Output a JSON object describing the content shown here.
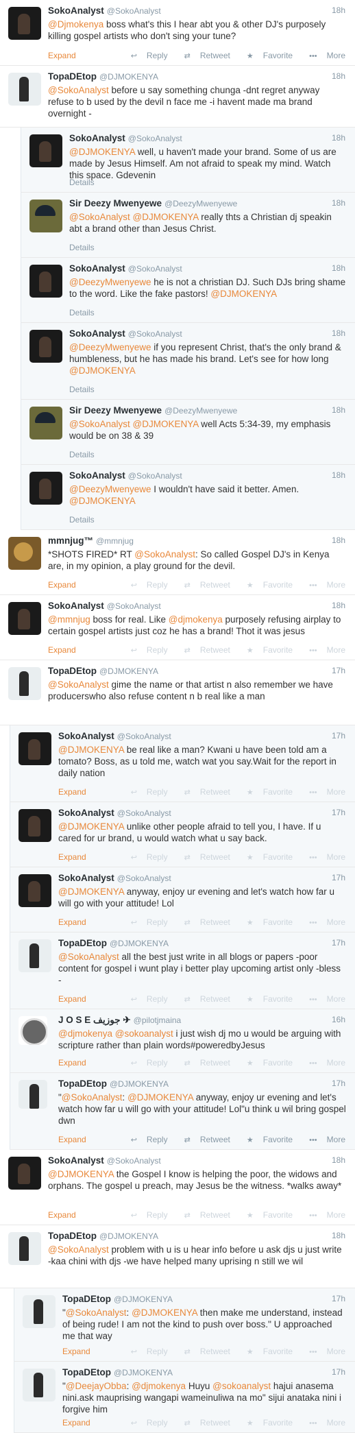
{
  "labels": {
    "expand": "Expand",
    "details": "Details",
    "reply": "Reply",
    "retweet": "Retweet",
    "favorite": "Favorite",
    "more": "More"
  },
  "icons": {
    "reply": "reply-arrow-icon",
    "retweet": "retweet-icon",
    "favorite": "star-icon",
    "more": "ellipsis-icon"
  },
  "colors": {
    "mention": "#e8883a",
    "meta": "#8899a6"
  },
  "tweets": [
    {
      "name": "SokoAnalyst",
      "handle": "@SokoAnalyst",
      "time": "18h",
      "mention1": "@Djmokenya",
      "text_main": " boss what's this I hear abt you & other DJ's purposely killing gospel artists who don't sing your tune?"
    },
    {
      "name": "TopaDEtop",
      "handle": "@DJMOKENYA",
      "time": "18h",
      "mention1": "@SokoAnalyst",
      "text_main": " before u say something chunga -dnt regret anyway refuse to b used by the devil n face me -i havent made ma brand overnight -"
    },
    {
      "name": "SokoAnalyst",
      "handle": "@SokoAnalyst",
      "time": "18h",
      "mention1": "@DJMOKENYA",
      "text_main": " well, u haven't made your brand. Some of us are made by Jesus Himself. Am not afraid to speak my mind. Watch this space. Gdevenin"
    },
    {
      "name": "Sir Deezy Mwenyewe",
      "handle": "@DeezyMwenyewe",
      "time": "18h",
      "mention1": "@SokoAnalyst",
      "mention2": "@DJMOKENYA",
      "text_main": " really thts a Christian dj speakin abt a brand other than Jesus Christ."
    },
    {
      "name": "SokoAnalyst",
      "handle": "@SokoAnalyst",
      "time": "18h",
      "mention1": "@DeezyMwenyewe",
      "text_main": " he is not a christian DJ. Such DJs bring shame to the word. Like the fake pastors! ",
      "mention_end": "@DJMOKENYA"
    },
    {
      "name": "SokoAnalyst",
      "handle": "@SokoAnalyst",
      "time": "18h",
      "mention1": "@DeezyMwenyewe",
      "text_main": " if you represent Christ, that's the only brand & humbleness, but he has made his brand. Let's see for how long ",
      "mention_end": "@DJMOKENYA"
    },
    {
      "name": "Sir Deezy Mwenyewe",
      "handle": "@DeezyMwenyewe",
      "time": "18h",
      "mention1": "@SokoAnalyst",
      "mention2": "@DJMOKENYA",
      "text_main": " well Acts 5:34-39, my emphasis would be on 38 & 39"
    },
    {
      "name": "SokoAnalyst",
      "handle": "@SokoAnalyst",
      "time": "18h",
      "mention1": "@DeezyMwenyewe",
      "text_main": " I wouldn't have said it better. Amen. ",
      "mention_end": "@DJMOKENYA"
    },
    {
      "name": "mmnjug™",
      "handle": "@mmnjug",
      "time": "18h",
      "text_pre": "*SHOTS FIRED* RT ",
      "mention1": "@SokoAnalyst",
      "text_main": ": So called Gospel DJ's in Kenya are, in my opinion, a play ground for the devil."
    },
    {
      "name": "SokoAnalyst",
      "handle": "@SokoAnalyst",
      "time": "18h",
      "mention1": "@mmnjug",
      "text_main": " boss for real. Like ",
      "mention2": "@djmokenya",
      "text_after": " purposely refusing airplay to certain gospel artists just coz he has a brand! Thot it was jesus"
    },
    {
      "name": "TopaDEtop",
      "handle": "@DJMOKENYA",
      "time": "17h",
      "mention1": "@SokoAnalyst",
      "text_main": " gime the name or that artist n also remember we have producerswho also refuse content n b real  like a man"
    },
    {
      "name": "SokoAnalyst",
      "handle": "@SokoAnalyst",
      "time": "17h",
      "mention1": "@DJMOKENYA",
      "text_main": " be real like a man? Kwani u have been told am a tomato? Boss, as u told me, watch wat you say.Wait for the report in daily nation"
    },
    {
      "name": "SokoAnalyst",
      "handle": "@SokoAnalyst",
      "time": "17h",
      "mention1": "@DJMOKENYA",
      "text_main": " unlike other people afraid to tell you, I have. If u cared for ur brand, u would watch what u say back."
    },
    {
      "name": "SokoAnalyst",
      "handle": "@SokoAnalyst",
      "time": "17h",
      "mention1": "@DJMOKENYA",
      "text_main": " anyway, enjoy ur evening and let's watch how far u will go with your attitude! Lol"
    },
    {
      "name": "TopaDEtop",
      "handle": "@DJMOKENYA",
      "time": "17h",
      "mention1": "@SokoAnalyst",
      "text_main": " all the best just write in all blogs or papers -poor content for gospel i wunt play i better play upcoming artist only -bless -"
    },
    {
      "name": "J O S E جوزيف ✈",
      "handle": "@pilotjmaina",
      "time": "16h",
      "mention1": "@djmokenya",
      "mention2": "@sokoanalyst",
      "text_main": " i just wish dj mo u would be arguing with scripture rather than plain words#poweredbyJesus"
    },
    {
      "name": "TopaDEtop",
      "handle": "@DJMOKENYA",
      "time": "17h",
      "text_pre": "\"",
      "mention1": "@SokoAnalyst",
      "text_mid": ": ",
      "mention2": "@DJMOKENYA",
      "text_main": " anyway, enjoy ur evening and let's watch how far u will go with your attitude! Lol\"u think u wil bring gospel dwn"
    },
    {
      "name": "SokoAnalyst",
      "handle": "@SokoAnalyst",
      "time": "18h",
      "mention1": "@DJMOKENYA",
      "text_main": " the Gospel I know is helping the poor, the widows and orphans. The gospel u preach, may Jesus be the witness. *walks away*"
    },
    {
      "name": "TopaDEtop",
      "handle": "@DJMOKENYA",
      "time": "18h",
      "mention1": "@SokoAnalyst",
      "text_main": " problem with u is u hear info before u ask djs u just write -kaa chini with djs -we have helped many uprising n still we wil"
    },
    {
      "name": "TopaDEtop",
      "handle": "@DJMOKENYA",
      "time": "17h",
      "text_pre": "\"",
      "mention1": "@SokoAnalyst",
      "text_mid": ": ",
      "mention2": "@DJMOKENYA",
      "text_main": " then make me understand, instead of being rude! I am not the kind to push over boss.\" U approached me that way"
    },
    {
      "name": "TopaDEtop",
      "handle": "@DJMOKENYA",
      "time": "17h",
      "text_pre": "\"",
      "mention1": "@DeejayObba",
      "text_mid": ": ",
      "mention2": "@djmokenya",
      "text_main": " Huyu ",
      "mention3": "@sokoanalyst",
      "text_after": " hajui anasema nini.ask mauprising wangapi wameinuliwa na mo\" sijui anataka nini i forgive him"
    }
  ]
}
